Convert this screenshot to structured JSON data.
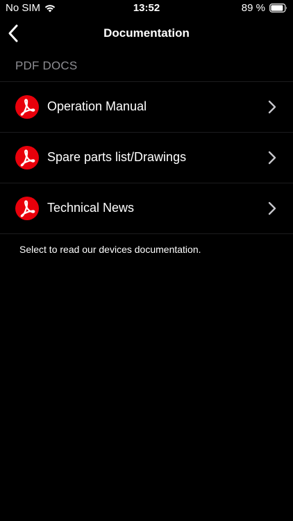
{
  "status_bar": {
    "carrier": "No SIM",
    "time": "13:52",
    "battery": "89 %"
  },
  "nav": {
    "title": "Documentation"
  },
  "section": {
    "header": "PDF DOCS"
  },
  "items": [
    {
      "label": "Operation Manual"
    },
    {
      "label": "Spare parts list/Drawings"
    },
    {
      "label": "Technical News"
    }
  ],
  "footer": {
    "text": "Select to read our devices documentation."
  },
  "colors": {
    "background": "#000000",
    "icon_red": "#e8000b",
    "separator": "#1c1c1e",
    "section_gray": "#8e8e93"
  }
}
